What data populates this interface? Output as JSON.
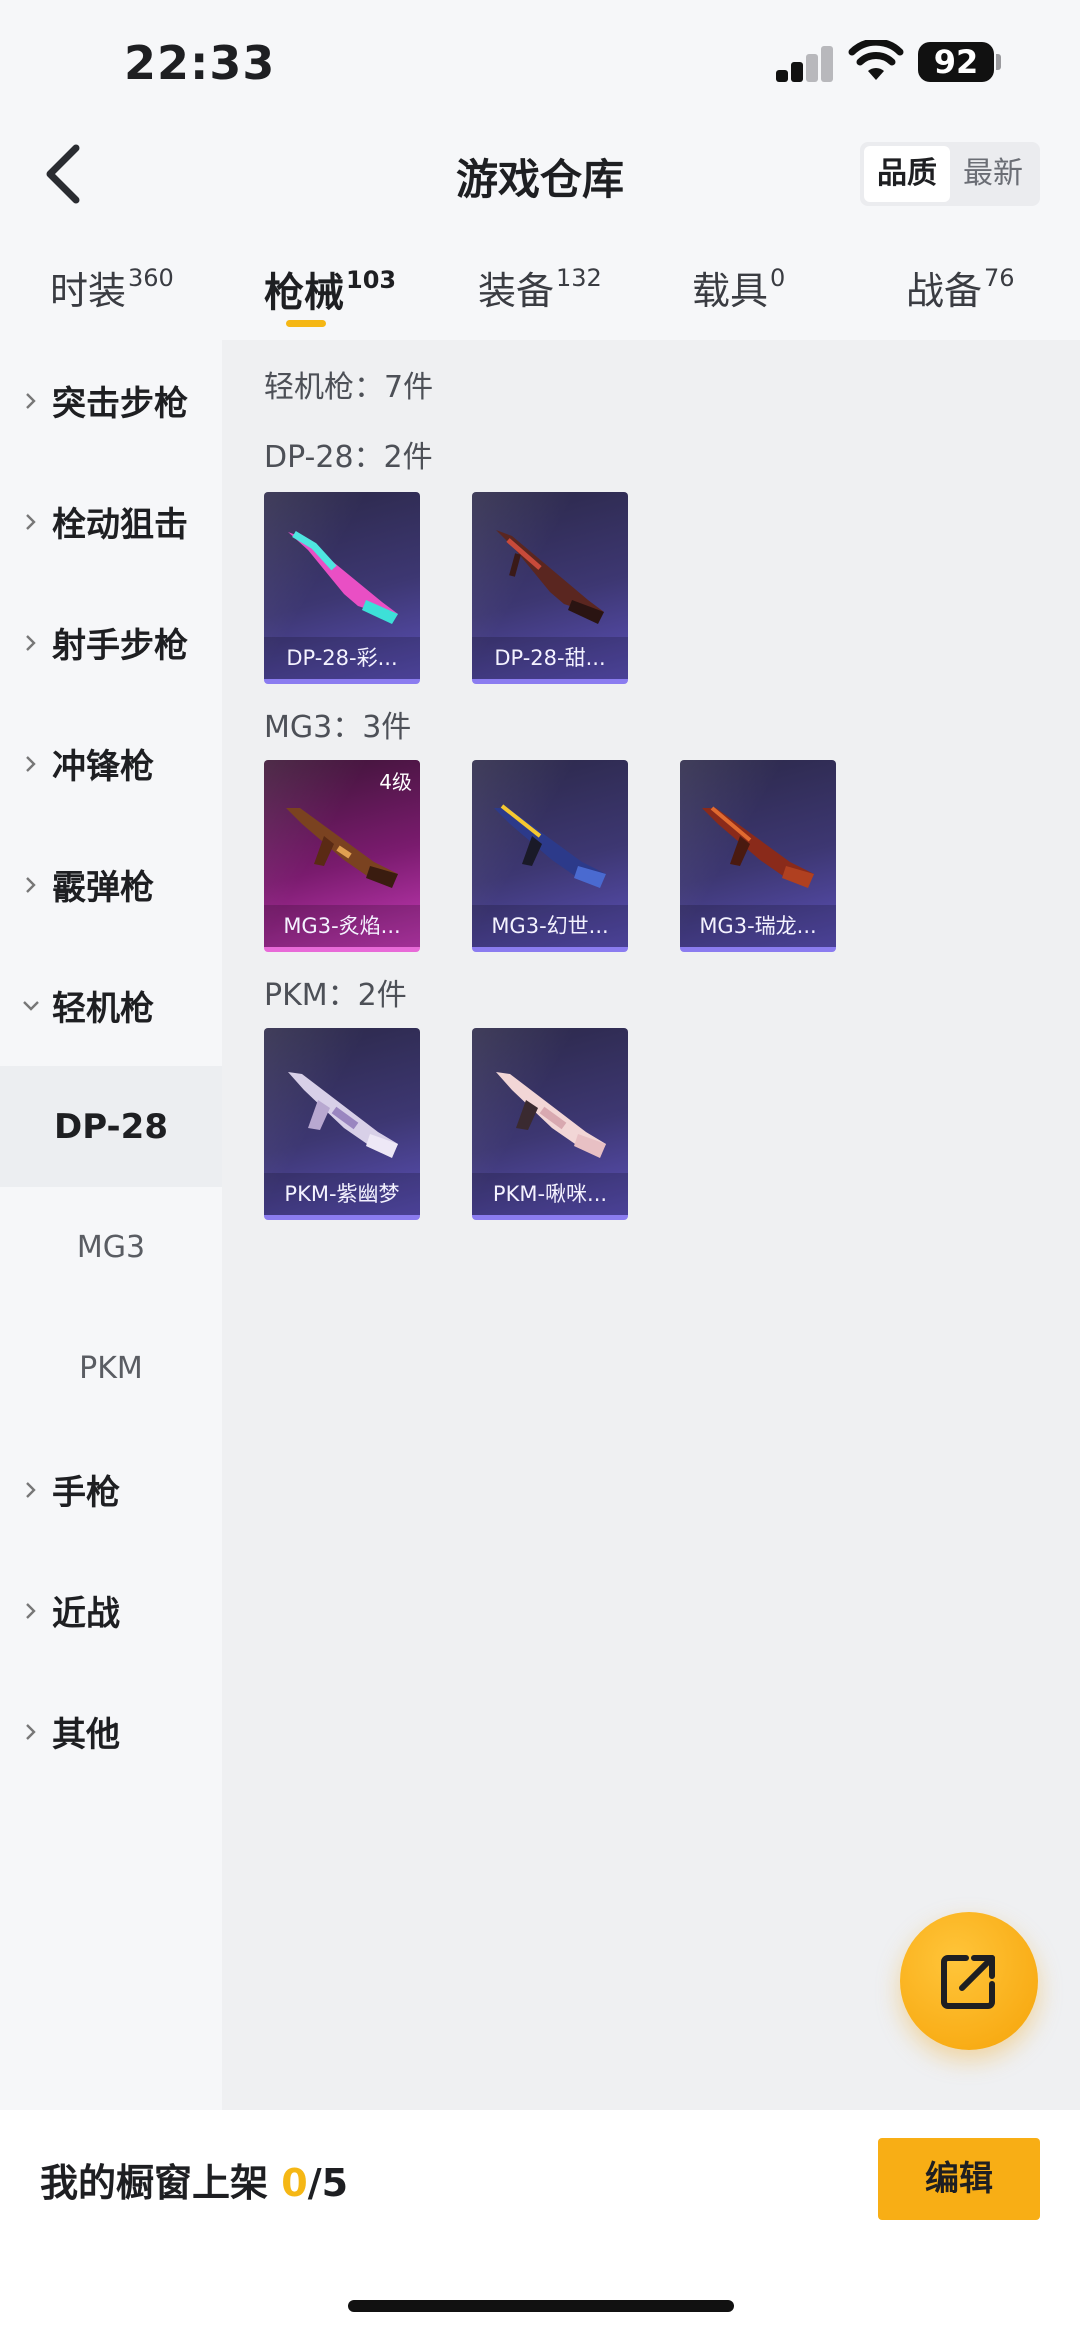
{
  "status_bar": {
    "time": "22:33",
    "battery": "92"
  },
  "header": {
    "title": "游戏仓库",
    "sort_options": [
      "品质",
      "最新"
    ],
    "sort_active": "品质"
  },
  "tabs": [
    {
      "label": "时装",
      "count": "360"
    },
    {
      "label": "枪械",
      "count": "103"
    },
    {
      "label": "装备",
      "count": "132"
    },
    {
      "label": "载具",
      "count": "0"
    },
    {
      "label": "战备",
      "count": "76"
    }
  ],
  "sidebar": {
    "categories": [
      "突击步枪",
      "栓动狙击",
      "射手步枪",
      "冲锋枪",
      "霰弹枪",
      "轻机枪"
    ],
    "sub_items": [
      "DP-28",
      "MG3",
      "PKM"
    ],
    "more_categories": [
      "手枪",
      "近战",
      "其他"
    ]
  },
  "main": {
    "category_label": "轻机枪：7件",
    "groups": [
      {
        "label": "DP-28：2件",
        "items": [
          {
            "name": "DP-28-彩...",
            "level": ""
          },
          {
            "name": "DP-28-甜...",
            "level": ""
          }
        ]
      },
      {
        "label": "MG3：3件",
        "items": [
          {
            "name": "MG3-炙焰...",
            "level": "4级"
          },
          {
            "name": "MG3-幻世...",
            "level": ""
          },
          {
            "name": "MG3-瑞龙...",
            "level": ""
          }
        ]
      },
      {
        "label": "PKM：2件",
        "items": [
          {
            "name": "PKM-紫幽梦",
            "level": ""
          },
          {
            "name": "PKM-啾咪...",
            "level": ""
          }
        ]
      }
    ]
  },
  "bottom_bar": {
    "label": "我的橱窗上架 ",
    "count_current": "0",
    "count_total": "/5",
    "edit_label": "编辑"
  },
  "colors": {
    "accent": "#f5b715",
    "card_purple": "#5b50b8",
    "card_pink": "#c63bb8"
  }
}
